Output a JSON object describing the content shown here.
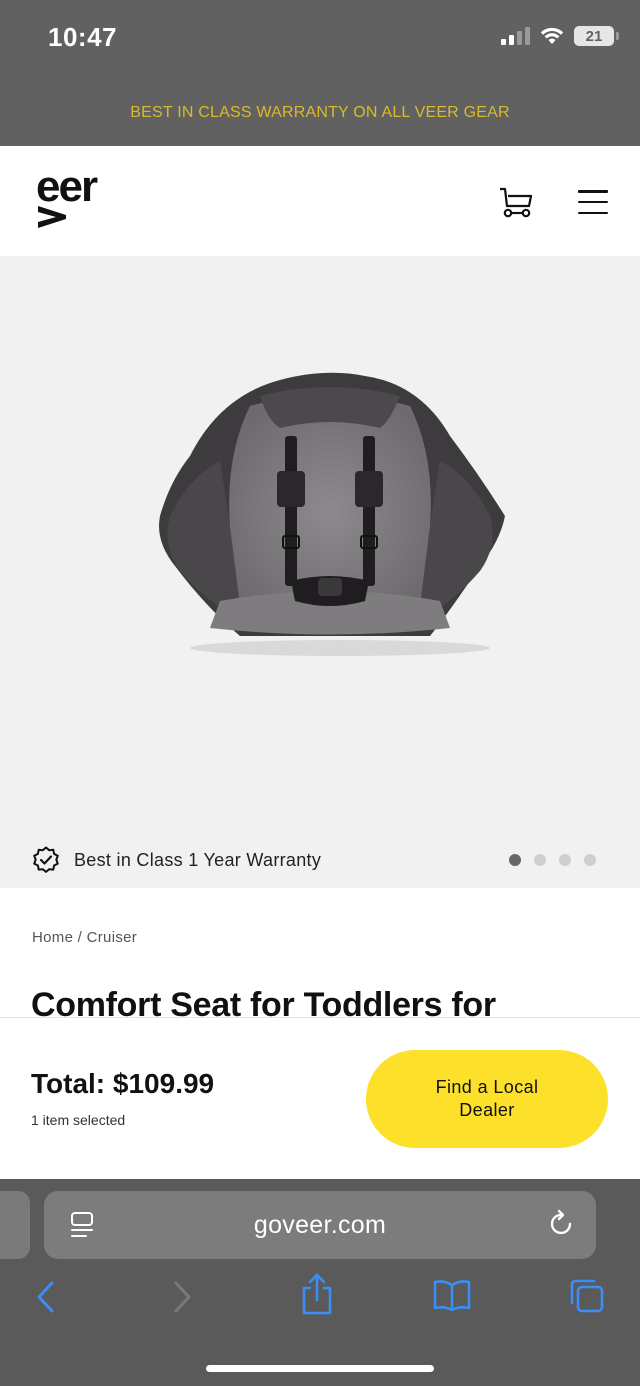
{
  "status_bar": {
    "time": "10:47",
    "battery": "21",
    "icons": [
      "signal-icon",
      "wifi-icon",
      "battery-icon"
    ]
  },
  "promo_banner": {
    "text": "BEST IN CLASS WARRANTY ON ALL VEER GEAR",
    "color": "#d8bb2a"
  },
  "header": {
    "logo_text": "eer",
    "icons": [
      "veer-logo",
      "cart-icon",
      "menu-icon"
    ]
  },
  "gallery": {
    "image": "toddler-comfort-seat-product-image",
    "warranty_text": "Best in Class 1 Year Warranty",
    "dots_count": 4,
    "active_dot": 1
  },
  "product": {
    "breadcrumb": {
      "home": "Home",
      "separator": " / ",
      "category": "Cruiser"
    },
    "title": "Comfort Seat for Toddlers for"
  },
  "purchase_bar": {
    "total": "Total: $109.99",
    "items_selected": "1 item selected",
    "dealer_button": "Find a Local Dealer",
    "accent_color": "#fde02a"
  },
  "browser": {
    "url": "goveer.com",
    "toolbar_icons": [
      "back-icon",
      "forward-icon",
      "share-icon",
      "bookmarks-icon",
      "tabs-icon"
    ]
  }
}
